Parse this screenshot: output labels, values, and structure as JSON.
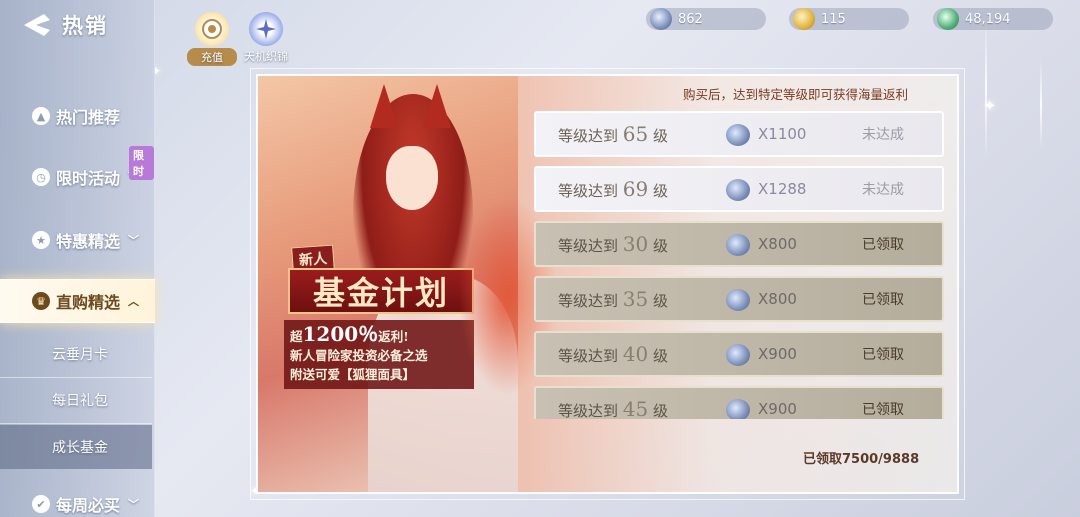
{
  "sidebar": {
    "title": "热销",
    "items": [
      {
        "label": "热门推荐"
      },
      {
        "label": "限时活动",
        "badge": "限时"
      },
      {
        "label": "特惠精选"
      },
      {
        "label": "直购精选"
      }
    ],
    "sub_items": [
      {
        "label": "云垂月卡"
      },
      {
        "label": "每日礼包"
      },
      {
        "label": "成长基金"
      }
    ],
    "last_item": {
      "label": "每周必买"
    }
  },
  "top_tabs": [
    {
      "label": "充值"
    },
    {
      "label": "天机织锦"
    }
  ],
  "currencies": [
    {
      "icon": "blue-gem-icon",
      "value": "862"
    },
    {
      "icon": "gold-coin-icon",
      "value": "115"
    },
    {
      "icon": "green-jade-icon",
      "value": "48,194"
    }
  ],
  "fund": {
    "promo": "购买后，达到特定等级即可获得海量返利",
    "tag": "新人",
    "title": "基金计划",
    "desc_prefix": "超",
    "desc_big": "1200％",
    "desc_suffix": "返利!",
    "desc_line2": "新人冒险家投资必备之选",
    "desc_line3": "附送可爱【狐狸面具】",
    "claimed_total": "已领取7500/9888"
  },
  "rewards": [
    {
      "prefix": "等级达到",
      "level": "65",
      "suffix": "级",
      "qty": "X1100",
      "status": "未达成",
      "state": "pending"
    },
    {
      "prefix": "等级达到",
      "level": "69",
      "suffix": "级",
      "qty": "X1288",
      "status": "未达成",
      "state": "pending"
    },
    {
      "prefix": "等级达到",
      "level": "30",
      "suffix": "级",
      "qty": "X800",
      "status": "已领取",
      "state": "claimed"
    },
    {
      "prefix": "等级达到",
      "level": "35",
      "suffix": "级",
      "qty": "X800",
      "status": "已领取",
      "state": "claimed"
    },
    {
      "prefix": "等级达到",
      "level": "40",
      "suffix": "级",
      "qty": "X900",
      "status": "已领取",
      "state": "claimed"
    },
    {
      "prefix": "等级达到",
      "level": "45",
      "suffix": "级",
      "qty": "X900",
      "status": "已领取",
      "state": "claimed"
    }
  ]
}
